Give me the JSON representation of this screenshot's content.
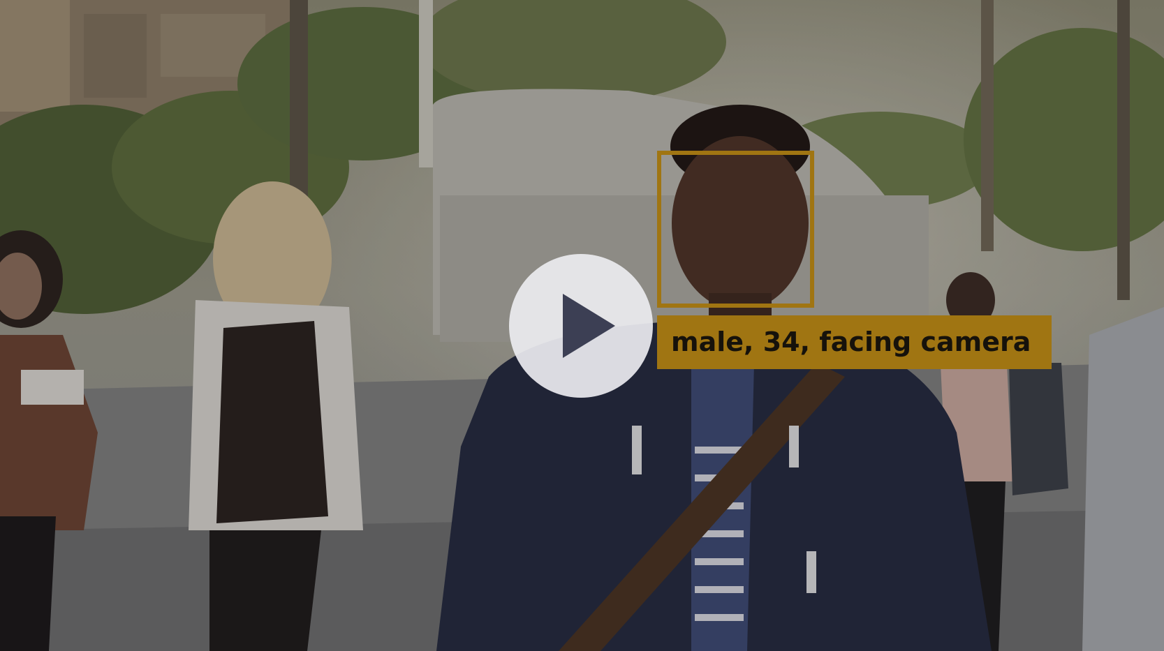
{
  "video": {
    "overlay_label": "male, 34, facing camera",
    "play_icon": "play-icon",
    "accent_color": "#a07512"
  }
}
